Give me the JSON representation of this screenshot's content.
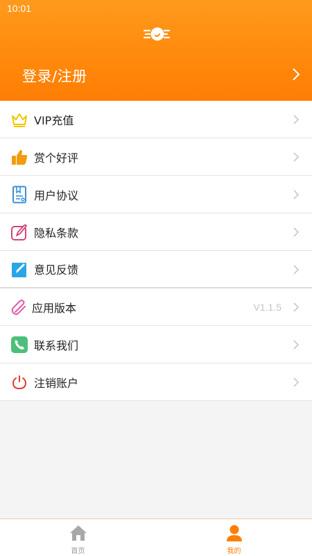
{
  "status_bar": {
    "time": "10:01"
  },
  "header": {
    "login_label": "登录/注册",
    "logo_icon": "motion-logo-icon"
  },
  "menu": {
    "items": [
      {
        "label": "VIP充值",
        "icon": "crown-icon"
      },
      {
        "label": "赏个好评",
        "icon": "thumbs-up-icon"
      },
      {
        "label": "用户协议",
        "icon": "document-icon"
      },
      {
        "label": "隐私条款",
        "icon": "edit-pen-icon"
      },
      {
        "label": "意见反馈",
        "icon": "feedback-pen-icon"
      },
      {
        "label": "应用版本",
        "icon": "paperclip-icon",
        "value": "V1.1.5"
      },
      {
        "label": "联系我们",
        "icon": "phone-icon"
      },
      {
        "label": "注销账户",
        "icon": "power-icon"
      }
    ]
  },
  "tabbar": {
    "tabs": [
      {
        "label": "首页",
        "icon": "home-icon",
        "active": false
      },
      {
        "label": "我的",
        "icon": "person-icon",
        "active": true
      }
    ]
  },
  "colors": {
    "accent": "#ff8a0c",
    "active_tab": "#ff7e00"
  }
}
